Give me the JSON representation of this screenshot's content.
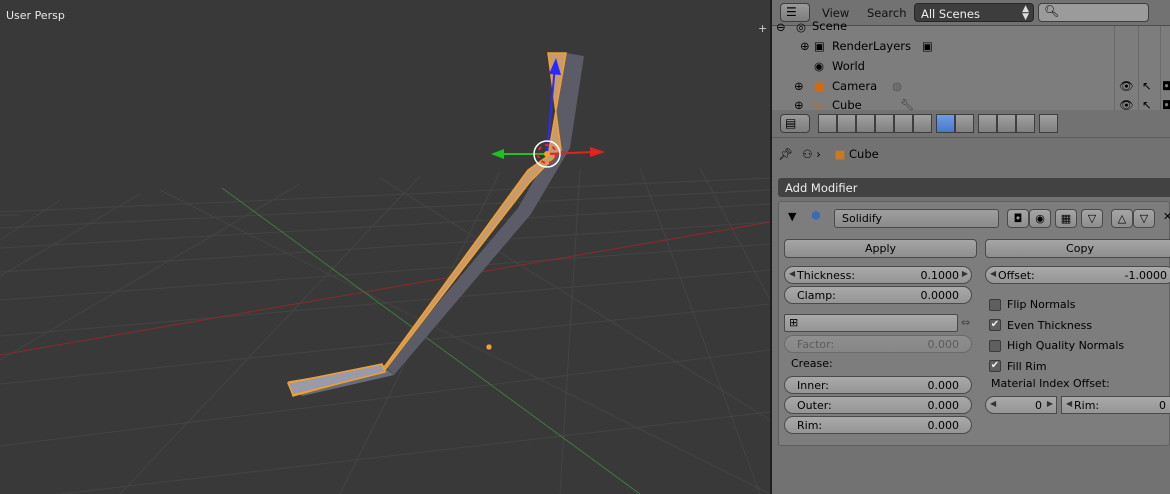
{
  "viewport": {
    "label": "User Persp",
    "plus": "+"
  },
  "outliner": {
    "menu_view": "View",
    "menu_search": "Search",
    "scene_select": "All Scenes",
    "rows": [
      {
        "name": "Scene"
      },
      {
        "name": "RenderLayers"
      },
      {
        "name": "World"
      },
      {
        "name": "Camera"
      },
      {
        "name": "Cube"
      }
    ]
  },
  "properties": {
    "breadcrumb_object": "Cube",
    "add_modifier": "Add Modifier",
    "modifier": {
      "name": "Solidify",
      "apply_label": "Apply",
      "copy_label": "Copy",
      "thickness_label": "Thickness:",
      "thickness_value": "0.1000",
      "offset_label": "Offset:",
      "offset_value": "-1.0000",
      "clamp_label": "Clamp:",
      "clamp_value": "0.0000",
      "flip_normals": "Flip Normals",
      "even_thickness": "Even Thickness",
      "high_quality_normals": "High Quality Normals",
      "fill_rim": "Fill Rim",
      "factor_label": "Factor:",
      "factor_value": "0.000",
      "crease_label": "Crease:",
      "inner_label": "Inner:",
      "inner_value": "0.000",
      "outer_label": "Outer:",
      "outer_value": "0.000",
      "rim_label": "Rim:",
      "rim_value": "0.000",
      "material_index_label": "Material Index Offset:",
      "mat_index_value": "0",
      "mat_rim_label": "Rim:",
      "mat_rim_value": "0"
    },
    "checkboxes": {
      "flip_normals": false,
      "even_thickness": true,
      "high_quality_normals": false,
      "fill_rim": true
    }
  }
}
